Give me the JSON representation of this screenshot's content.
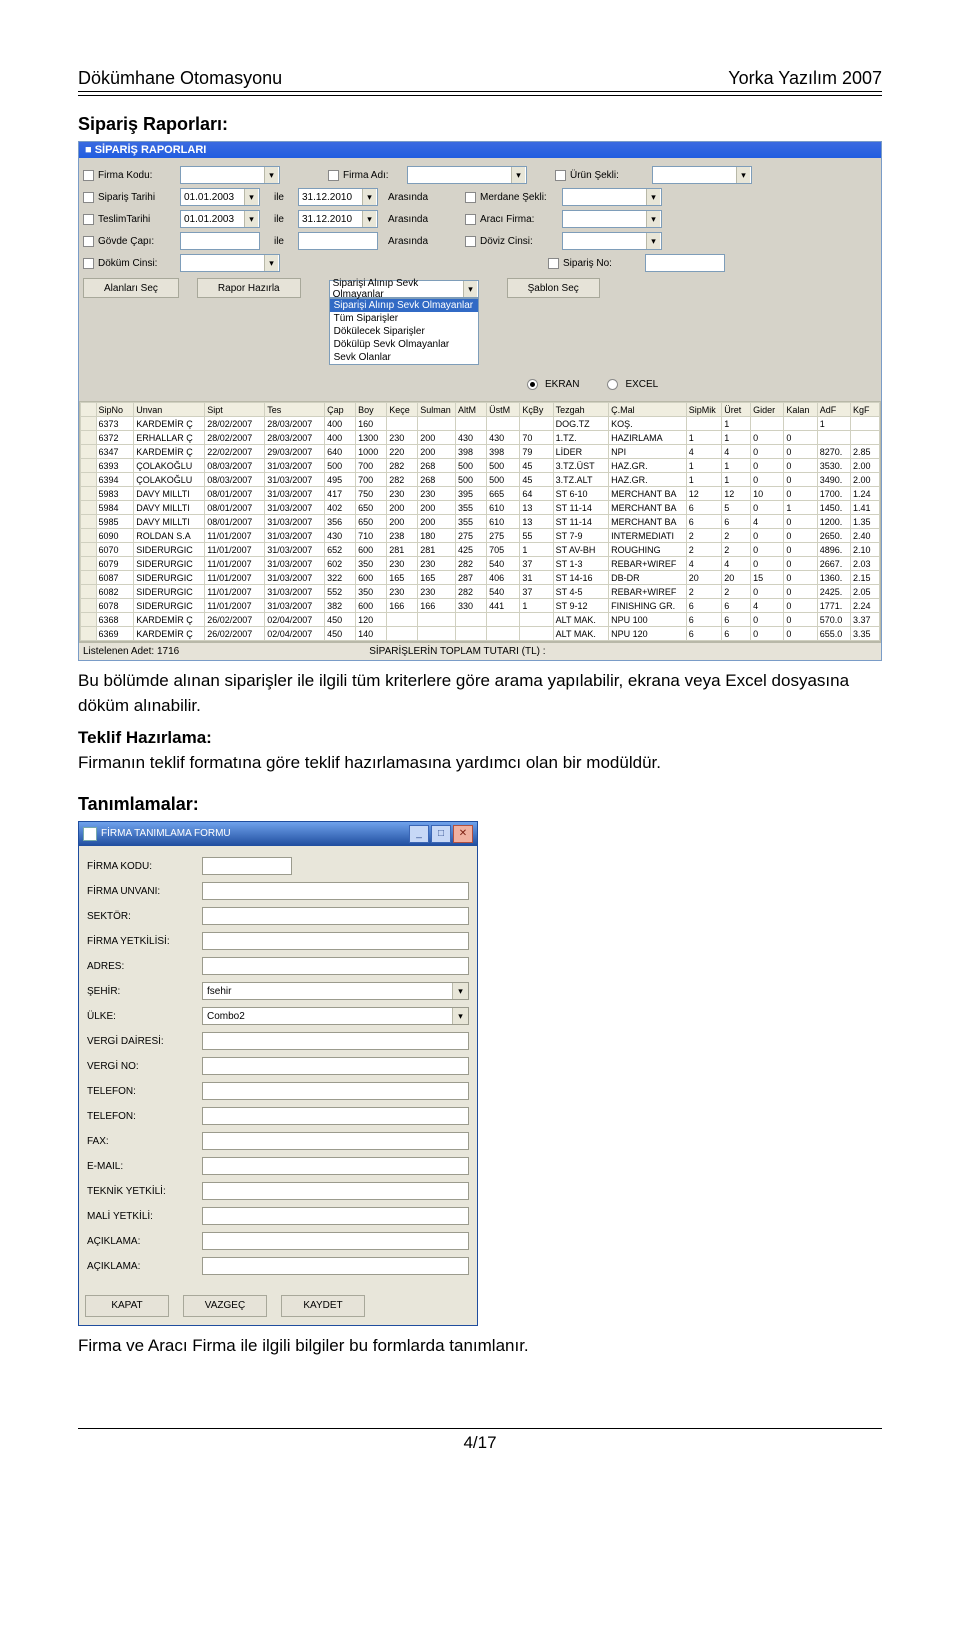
{
  "doc": {
    "left_head": "Dökümhane Otomasyonu",
    "right_head": "Yorka Yazılım 2007",
    "section1_title": "Sipariş Raporları:",
    "body1": "Bu bölümde alınan siparişler ile ilgili tüm kriterlere göre arama yapılabilir, ekrana veya Excel dosyasına döküm alınabilir.",
    "section2_title": "Teklif Hazırlama:",
    "body2": "Firmanın teklif formatına göre teklif hazırlamasına yardımcı olan bir modüldür.",
    "section3_title": "Tanımlamalar:",
    "body3": "Firma ve Aracı Firma ile ilgili bilgiler bu formlarda tanımlanır.",
    "pager": "4/17"
  },
  "rapor": {
    "titlebar": "SİPARİŞ RAPORLARI",
    "labels": {
      "firma_kodu": "Firma Kodu:",
      "firma_adi": "Firma Adı:",
      "urun_sekli": "Ürün Şekli:",
      "siparis_tarihi": "Sipariş Tarihi",
      "teslim_tarihi": "TeslimTarihi",
      "ile": "ile",
      "arasinda": "Arasında",
      "merdane_sekli": "Merdane Şekli:",
      "araci_firma": "Aracı Firma:",
      "govde_capi": "Gövde Çapı:",
      "doviz_cinsi": "Döviz Cinsi:",
      "dokum_cinsi": "Döküm Cinsi:",
      "siparis_no": "Sipariş No:",
      "alanlari_sec": "Alanları Seç",
      "rapor_hazirla": "Rapor Hazırla",
      "sablon_sec": "Şablon Seç",
      "ekran": "EKRAN",
      "excel": "EXCEL",
      "status_left": "Listelenen Adet: 1716",
      "status_right": "SİPARİŞLERİN TOPLAM TUTARI (TL) :"
    },
    "dates": {
      "d1": "01.01.2003",
      "d2": "31.12.2010"
    },
    "filter_combo_selected": "Siparişi Alınıp Sevk Olmayanlar",
    "filter_combo_items": [
      "Siparişi Alınıp Sevk Olmayanlar",
      "Tüm Siparişler",
      "Dökülecek Siparişler",
      "Dökülüp Sevk Olmayanlar",
      "Sevk Olanlar"
    ],
    "grid_headers": [
      "SipNo",
      "Unvan",
      "Sipt",
      "Tes",
      "Çap",
      "Boy",
      "Keçe",
      "Sulman",
      "AltM",
      "ÜstM",
      "KçBy",
      "Tezgah",
      "Ç.Mal",
      "SipMik",
      "Üret",
      "Gider",
      "Kalan",
      "AdF",
      "KgF"
    ],
    "grid_rows": [
      [
        "6373",
        "KARDEMİR Ç",
        "28/02/2007",
        "28/03/2007",
        "400",
        "160",
        "",
        "",
        "",
        "",
        "",
        "DOG.TZ",
        "KOŞ.",
        "",
        "1",
        "",
        "",
        "1",
        ""
      ],
      [
        "6372",
        "ERHALLAR Ç",
        "28/02/2007",
        "28/03/2007",
        "400",
        "1300",
        "230",
        "200",
        "430",
        "430",
        "70",
        "1.TZ.",
        "HAZIRLAMA",
        "1",
        "1",
        "0",
        "0",
        "",
        ""
      ],
      [
        "6347",
        "KARDEMİR Ç",
        "22/02/2007",
        "29/03/2007",
        "640",
        "1000",
        "220",
        "200",
        "398",
        "398",
        "79",
        "LİDER",
        "NPI",
        "4",
        "4",
        "0",
        "0",
        "8270.",
        "2.85"
      ],
      [
        "6393",
        "ÇOLAKOĞLU",
        "08/03/2007",
        "31/03/2007",
        "500",
        "700",
        "282",
        "268",
        "500",
        "500",
        "45",
        "3.TZ.ÜST",
        "HAZ.GR.",
        "1",
        "1",
        "0",
        "0",
        "3530.",
        "2.00"
      ],
      [
        "6394",
        "ÇOLAKOĞLU",
        "08/03/2007",
        "31/03/2007",
        "495",
        "700",
        "282",
        "268",
        "500",
        "500",
        "45",
        "3.TZ.ALT",
        "HAZ.GR.",
        "1",
        "1",
        "0",
        "0",
        "3490.",
        "2.00"
      ],
      [
        "5983",
        "DAVY MILLTI",
        "08/01/2007",
        "31/03/2007",
        "417",
        "750",
        "230",
        "230",
        "395",
        "665",
        "64",
        "ST 6-10",
        "MERCHANT BA",
        "12",
        "12",
        "10",
        "0",
        "1700.",
        "1.24"
      ],
      [
        "5984",
        "DAVY MILLTI",
        "08/01/2007",
        "31/03/2007",
        "402",
        "650",
        "200",
        "200",
        "355",
        "610",
        "13",
        "ST 11-14",
        "MERCHANT BA",
        "6",
        "5",
        "0",
        "1",
        "1450.",
        "1.41"
      ],
      [
        "5985",
        "DAVY MILLTI",
        "08/01/2007",
        "31/03/2007",
        "356",
        "650",
        "200",
        "200",
        "355",
        "610",
        "13",
        "ST 11-14",
        "MERCHANT BA",
        "6",
        "6",
        "4",
        "0",
        "1200.",
        "1.35"
      ],
      [
        "6090",
        "ROLDAN S.A",
        "11/01/2007",
        "31/03/2007",
        "430",
        "710",
        "238",
        "180",
        "275",
        "275",
        "55",
        "ST 7-9",
        "INTERMEDIATI",
        "2",
        "2",
        "0",
        "0",
        "2650.",
        "2.40"
      ],
      [
        "6070",
        "SIDERURGIC",
        "11/01/2007",
        "31/03/2007",
        "652",
        "600",
        "281",
        "281",
        "425",
        "705",
        "1",
        "ST AV-BH",
        "ROUGHING",
        "2",
        "2",
        "0",
        "0",
        "4896.",
        "2.10"
      ],
      [
        "6079",
        "SIDERURGIC",
        "11/01/2007",
        "31/03/2007",
        "602",
        "350",
        "230",
        "230",
        "282",
        "540",
        "37",
        "ST 1-3",
        "REBAR+WIREF",
        "4",
        "4",
        "0",
        "0",
        "2667.",
        "2.03"
      ],
      [
        "6087",
        "SIDERURGIC",
        "11/01/2007",
        "31/03/2007",
        "322",
        "600",
        "165",
        "165",
        "287",
        "406",
        "31",
        "ST 14-16",
        "DB-DR",
        "20",
        "20",
        "15",
        "0",
        "1360.",
        "2.15"
      ],
      [
        "6082",
        "SIDERURGIC",
        "11/01/2007",
        "31/03/2007",
        "552",
        "350",
        "230",
        "230",
        "282",
        "540",
        "37",
        "ST 4-5",
        "REBAR+WIREF",
        "2",
        "2",
        "0",
        "0",
        "2425.",
        "2.05"
      ],
      [
        "6078",
        "SIDERURGIC",
        "11/01/2007",
        "31/03/2007",
        "382",
        "600",
        "166",
        "166",
        "330",
        "441",
        "1",
        "ST 9-12",
        "FINISHING GR.",
        "6",
        "6",
        "4",
        "0",
        "1771.",
        "2.24"
      ],
      [
        "6368",
        "KARDEMİR Ç",
        "26/02/2007",
        "02/04/2007",
        "450",
        "120",
        "",
        "",
        "",
        "",
        "",
        "ALT MAK.",
        "NPU 100",
        "6",
        "6",
        "0",
        "0",
        "570.0",
        "3.37"
      ],
      [
        "6369",
        "KARDEMİR Ç",
        "26/02/2007",
        "02/04/2007",
        "450",
        "140",
        "",
        "",
        "",
        "",
        "",
        "ALT MAK.",
        "NPU 120",
        "6",
        "6",
        "0",
        "0",
        "655.0",
        "3.35"
      ]
    ]
  },
  "form": {
    "titlebar": "FİRMA TANIMLAMA FORMU",
    "fields": [
      {
        "label": "FİRMA KODU:",
        "type": "text",
        "w": "short"
      },
      {
        "label": "FİRMA UNVANI:",
        "type": "text",
        "w": "full"
      },
      {
        "label": "SEKTÖR:",
        "type": "text",
        "w": "full"
      },
      {
        "label": "FİRMA YETKİLİSİ:",
        "type": "text",
        "w": "full"
      },
      {
        "label": "ADRES:",
        "type": "text",
        "w": "full"
      },
      {
        "label": "ŞEHİR:",
        "type": "combo",
        "value": "fsehir"
      },
      {
        "label": "ÜLKE:",
        "type": "combo",
        "value": "Combo2"
      },
      {
        "label": "VERGİ DAİRESİ:",
        "type": "text",
        "w": "full"
      },
      {
        "label": "VERGİ NO:",
        "type": "text",
        "w": "full"
      },
      {
        "label": "TELEFON:",
        "type": "text",
        "w": "full"
      },
      {
        "label": "TELEFON:",
        "type": "text",
        "w": "full"
      },
      {
        "label": "FAX:",
        "type": "text",
        "w": "full"
      },
      {
        "label": "E-MAIL:",
        "type": "text",
        "w": "full"
      },
      {
        "label": "TEKNİK YETKİLİ:",
        "type": "text",
        "w": "full"
      },
      {
        "label": "MALİ YETKİLİ:",
        "type": "text",
        "w": "full"
      },
      {
        "label": "AÇIKLAMA:",
        "type": "text",
        "w": "full"
      },
      {
        "label": "AÇIKLAMA:",
        "type": "text",
        "w": "full"
      }
    ],
    "buttons": {
      "kapat": "KAPAT",
      "vazgec": "VAZGEÇ",
      "kaydet": "KAYDET"
    }
  }
}
